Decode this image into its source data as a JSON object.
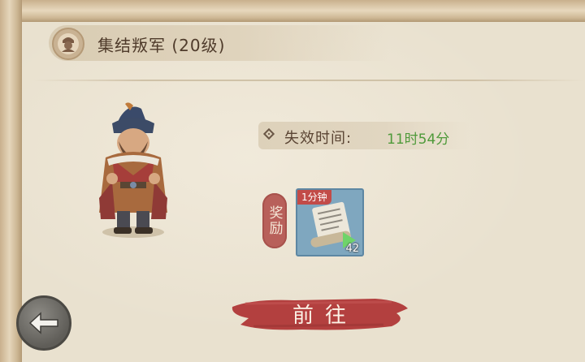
{
  "event": {
    "title": "集结叛军 (20级)",
    "expire_label": "失效时间:",
    "expire_value": "11时54分"
  },
  "reward": {
    "tag_label": "奖励",
    "item": {
      "timer_label": "1分钟",
      "count": "42",
      "icon": "scroll-icon"
    }
  },
  "actions": {
    "go_label": "前往",
    "back_icon": "back-arrow-icon"
  },
  "colors": {
    "paper": "#e9e1cf",
    "title_text": "#4f3b2b",
    "expire_value": "#4f9a3a",
    "reward_tag": "#b8605a",
    "go_button": "#b3403f",
    "item_slot": "#7fa7bf"
  }
}
